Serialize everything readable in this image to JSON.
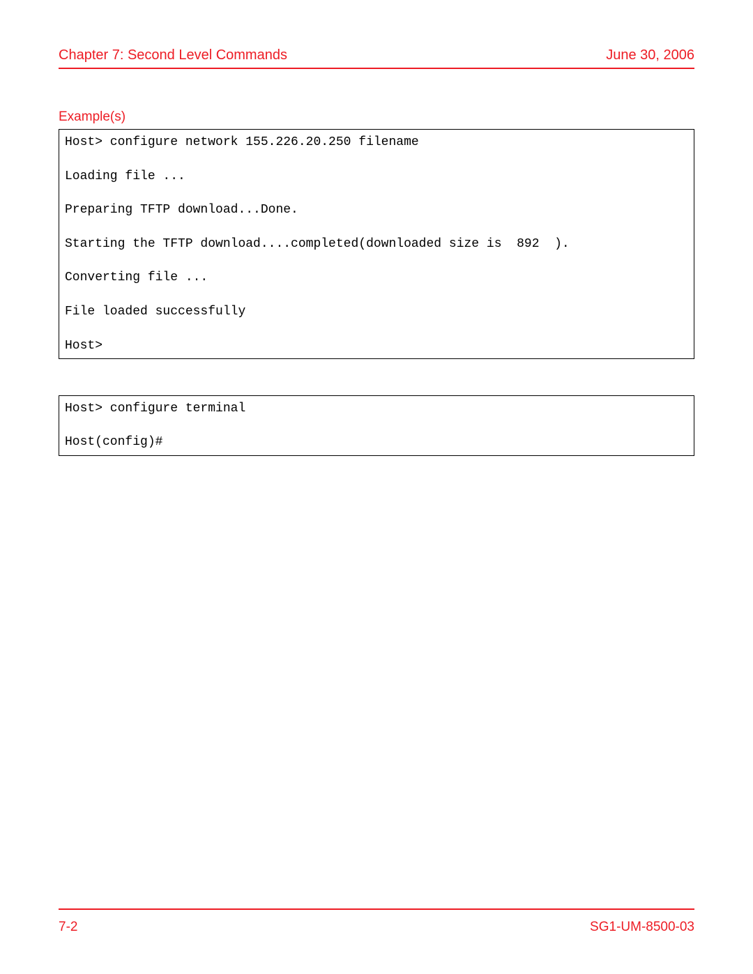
{
  "header": {
    "chapter": "Chapter 7: Second Level Commands",
    "date": "June 30, 2006"
  },
  "section": {
    "title": "Example(s)"
  },
  "codeBlocks": {
    "block1": "Host> configure network 155.226.20.250 filename\n\nLoading file ...\n\nPreparing TFTP download...Done.\n\nStarting the TFTP download....completed(downloaded size is  892  ).\n\nConverting file ...\n\nFile loaded successfully\n\nHost>",
    "block2": "Host> configure terminal\n\nHost(config)#"
  },
  "footer": {
    "pageNumber": "7-2",
    "docId": "SG1-UM-8500-03"
  }
}
